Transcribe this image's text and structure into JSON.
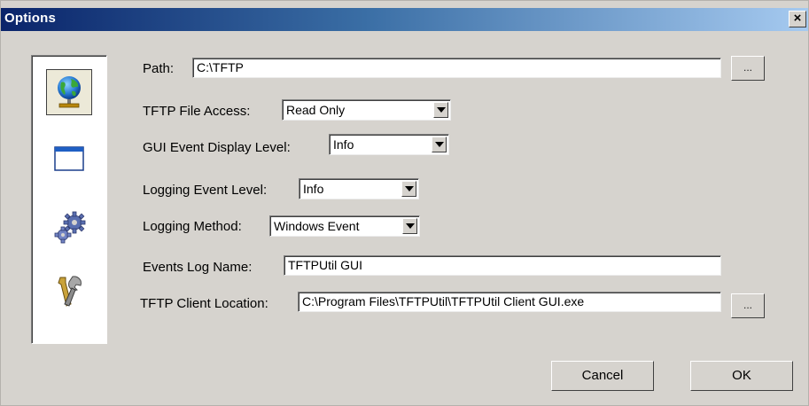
{
  "window": {
    "title": "Options",
    "close_label": "×"
  },
  "sidebar": {
    "items": [
      {
        "icon": "globe-network-icon",
        "selected": true
      },
      {
        "icon": "window-icon",
        "selected": false
      },
      {
        "icon": "gears-icon",
        "selected": false
      },
      {
        "icon": "tools-icon",
        "selected": false
      }
    ]
  },
  "form": {
    "path_label": "Path:",
    "path_value": "C:\\TFTP",
    "path_browse": "...",
    "file_access_label": "TFTP File Access:",
    "file_access_value": "Read Only",
    "gui_level_label": "GUI Event Display Level:",
    "gui_level_value": "Info",
    "log_level_label": "Logging Event Level:",
    "log_level_value": "Info",
    "log_method_label": "Logging Method:",
    "log_method_value": "Windows Event",
    "events_log_label": "Events Log Name:",
    "events_log_value": "TFTPUtil GUI",
    "client_loc_label": "TFTP Client Location:",
    "client_loc_value": "C:\\Program Files\\TFTPUtil\\TFTPUtil Client GUI.exe",
    "client_browse": "..."
  },
  "buttons": {
    "cancel": "Cancel",
    "ok": "OK"
  }
}
